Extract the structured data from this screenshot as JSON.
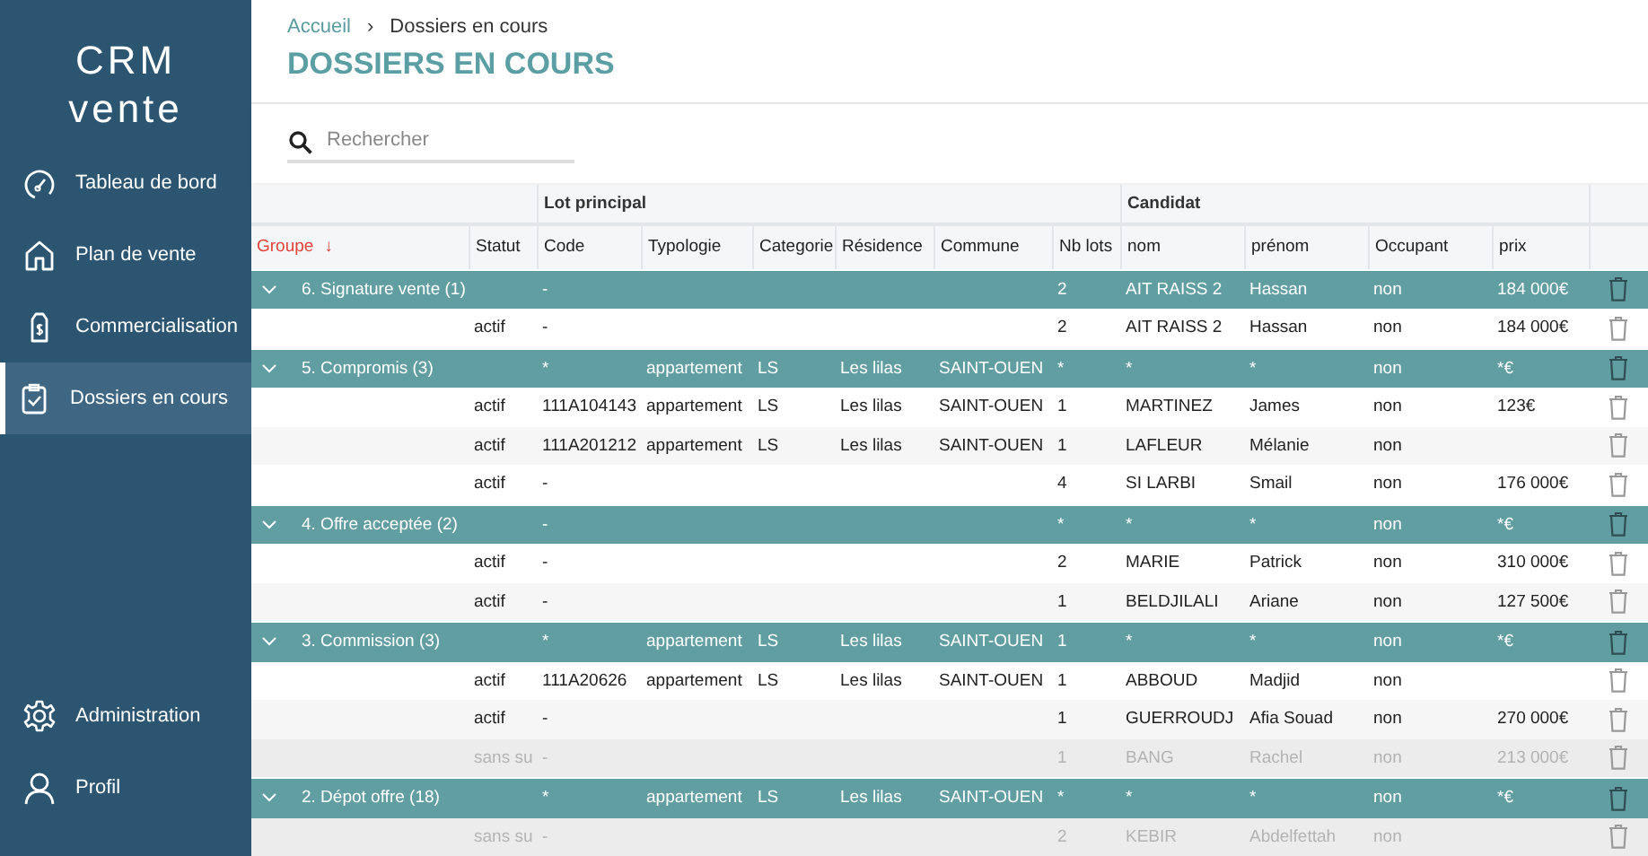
{
  "sidebar": {
    "logo": [
      "CRM",
      "vente"
    ],
    "items": [
      {
        "label": "Tableau de bord",
        "selected": false
      },
      {
        "label": "Plan de vente",
        "selected": false
      },
      {
        "label": "Commercialisation",
        "selected": false
      },
      {
        "label": "Dossiers en cours",
        "selected": true
      }
    ],
    "footer_items": [
      {
        "label": "Administration",
        "selected": false
      },
      {
        "label": "Profil",
        "selected": false
      }
    ]
  },
  "breadcrumb": {
    "link": "Accueil",
    "separator": "›",
    "current": "Dossiers en cours"
  },
  "title": "DOSSIERS EN COURS",
  "search": {
    "placeholder": "Rechercher"
  },
  "table": {
    "column_groups": [
      "Lot principal",
      "Candidat"
    ],
    "columns": [
      {
        "label": "Groupe",
        "sort": "↓"
      },
      {
        "label": "Statut"
      },
      {
        "label": "Code"
      },
      {
        "label": "Typologie"
      },
      {
        "label": "Categorie"
      },
      {
        "label": "Résidence"
      },
      {
        "label": "Commune"
      },
      {
        "label": "Nb lots"
      },
      {
        "label": "nom"
      },
      {
        "label": "prénom"
      },
      {
        "label": "Occupant"
      },
      {
        "label": "prix"
      }
    ],
    "rows": [
      {
        "kind": "group",
        "expanded": true,
        "cells": [
          "6. Signature vente (1)",
          "",
          "-",
          "",
          "",
          "",
          "",
          "2",
          "AIT RAISS 2",
          "Hassan",
          "non",
          "184 000€"
        ]
      },
      {
        "kind": "item",
        "muted": false,
        "cells": [
          "",
          "actif",
          "-",
          "",
          "",
          "",
          "",
          "2",
          "AIT RAISS 2",
          "Hassan",
          "non",
          "184 000€"
        ]
      },
      {
        "kind": "group",
        "expanded": true,
        "cells": [
          "5. Compromis (3)",
          "",
          "*",
          "appartement",
          "LS",
          "Les lilas",
          "SAINT-OUEN",
          "*",
          "*",
          "*",
          "non",
          "*€"
        ]
      },
      {
        "kind": "item",
        "muted": false,
        "cells": [
          "",
          "actif",
          "111A104143",
          "appartement",
          "LS",
          "Les lilas",
          "SAINT-OUEN",
          "1",
          "MARTINEZ",
          "James",
          "non",
          "123€"
        ]
      },
      {
        "kind": "item",
        "muted": false,
        "cells": [
          "",
          "actif",
          "111A201212",
          "appartement",
          "LS",
          "Les lilas",
          "SAINT-OUEN",
          "1",
          "LAFLEUR",
          "Mélanie",
          "non",
          ""
        ]
      },
      {
        "kind": "item",
        "muted": false,
        "cells": [
          "",
          "actif",
          "-",
          "",
          "",
          "",
          "",
          "4",
          "SI LARBI",
          "Smail",
          "non",
          "176 000€"
        ]
      },
      {
        "kind": "group",
        "expanded": true,
        "cells": [
          "4. Offre acceptée (2)",
          "",
          "-",
          "",
          "",
          "",
          "",
          "*",
          "*",
          "*",
          "non",
          "*€"
        ]
      },
      {
        "kind": "item",
        "muted": false,
        "cells": [
          "",
          "actif",
          "-",
          "",
          "",
          "",
          "",
          "2",
          "MARIE",
          "Patrick",
          "non",
          "310 000€"
        ]
      },
      {
        "kind": "item",
        "muted": false,
        "cells": [
          "",
          "actif",
          "-",
          "",
          "",
          "",
          "",
          "1",
          "BELDJILALI",
          "Ariane",
          "non",
          "127 500€"
        ]
      },
      {
        "kind": "group",
        "expanded": true,
        "cells": [
          "3. Commission (3)",
          "",
          "*",
          "appartement",
          "LS",
          "Les lilas",
          "SAINT-OUEN",
          "1",
          "*",
          "*",
          "non",
          "*€"
        ]
      },
      {
        "kind": "item",
        "muted": false,
        "cells": [
          "",
          "actif",
          "111A20626",
          "appartement",
          "LS",
          "Les lilas",
          "SAINT-OUEN",
          "1",
          "ABBOUD",
          "Madjid",
          "non",
          ""
        ]
      },
      {
        "kind": "item",
        "muted": false,
        "cells": [
          "",
          "actif",
          "-",
          "",
          "",
          "",
          "",
          "1",
          "GUERROUDJ",
          "Afia Souad",
          "non",
          "270 000€"
        ]
      },
      {
        "kind": "item",
        "muted": true,
        "cells": [
          "",
          "sans su",
          "-",
          "",
          "",
          "",
          "",
          "1",
          "BANG",
          "Rachel",
          "non",
          "213 000€"
        ]
      },
      {
        "kind": "group",
        "expanded": true,
        "cells": [
          "2. Dépot offre (18)",
          "",
          "*",
          "appartement",
          "LS",
          "Les lilas",
          "SAINT-OUEN",
          "*",
          "*",
          "*",
          "non",
          "*€"
        ]
      },
      {
        "kind": "item",
        "muted": true,
        "cells": [
          "",
          "sans su",
          "-",
          "",
          "",
          "",
          "",
          "2",
          "KEBIR",
          "Abdelfettah",
          "non",
          ""
        ]
      }
    ]
  }
}
